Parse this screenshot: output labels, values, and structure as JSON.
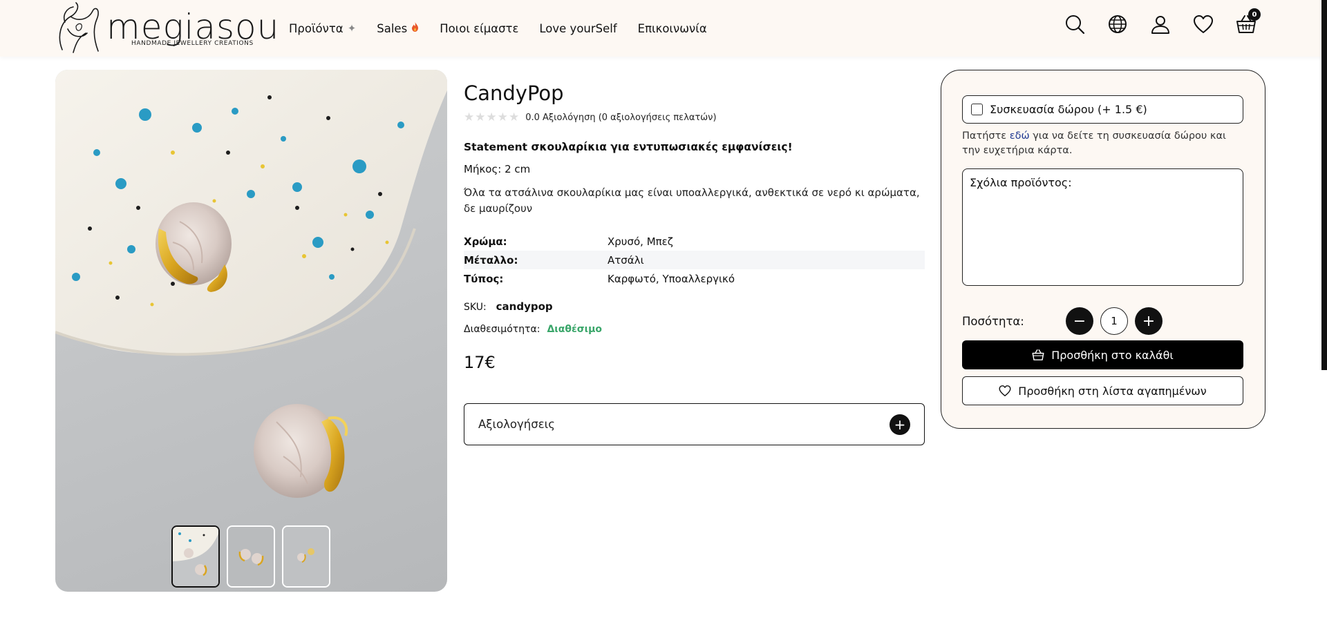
{
  "brand": {
    "name": "megiasou",
    "tagline": "HANDMADE JEWELLERY CREATIONS"
  },
  "nav": {
    "items": [
      {
        "label": "Προϊόντα",
        "icon": "sparkle-icon"
      },
      {
        "label": "Sales",
        "icon": "fire-icon"
      },
      {
        "label": "Ποιοι είμαστε"
      },
      {
        "label": "Love yourSelf"
      },
      {
        "label": "Επικοινωνία"
      }
    ]
  },
  "header_icons": {
    "search": "search-icon",
    "language": "globe-icon",
    "account": "user-icon",
    "wishlist": "heart-icon",
    "cart": "basket-icon",
    "cart_count": "0"
  },
  "product": {
    "title": "CandyPop",
    "rating_value": "0.0",
    "rating_text": "0.0 Αξιολόγηση (0 αξιολογήσεις πελατών)",
    "tagline": "Statement σκουλαρίκια για εντυπωσιακές εμφανίσεις!",
    "length": "Μήκος: 2 cm",
    "description": "Όλα τα ατσάλινα σκουλαρίκια μας είναι υποαλλεργικά, ανθεκτικά σε νερό κι αρώματα, δε μαυρίζουν",
    "attributes": [
      {
        "key": "Χρώμα:",
        "value": "Χρυσό, Μπεζ"
      },
      {
        "key": "Μέταλλο:",
        "value": "Ατσάλι"
      },
      {
        "key": "Τύπος:",
        "value": "Καρφωτό, Υποαλλεργικό"
      }
    ],
    "sku_label": "SKU:",
    "sku": "candypop",
    "availability_label": "Διαθεσιμότητα:",
    "availability": "Διαθέσιμο",
    "price": "17€",
    "reviews_label": "Αξιολογήσεις",
    "thumbnails_count": 3,
    "active_thumbnail": 1
  },
  "buybox": {
    "gift_wrap_label": "Συσκευασία δώρου (+ 1.5 €)",
    "gift_note_prefix": "Πατήστε ",
    "gift_note_link": "εδώ",
    "gift_note_suffix": " για να δείτε τη συσκευασία δώρου και την ευχετήρια κάρτα.",
    "comments_placeholder": "Σχόλια προϊόντος:",
    "quantity_label": "Ποσότητα:",
    "quantity": "1",
    "add_to_cart": "Προσθήκη στο καλάθι",
    "add_to_wishlist": "Προσθήκη στη λίστα αγαπημένων"
  },
  "colors": {
    "header_bg": "#fdf8f3",
    "accent_dark": "#111111",
    "available_green": "#3aa66a",
    "link_blue": "#1f3a93",
    "gold": "#d9a520"
  }
}
